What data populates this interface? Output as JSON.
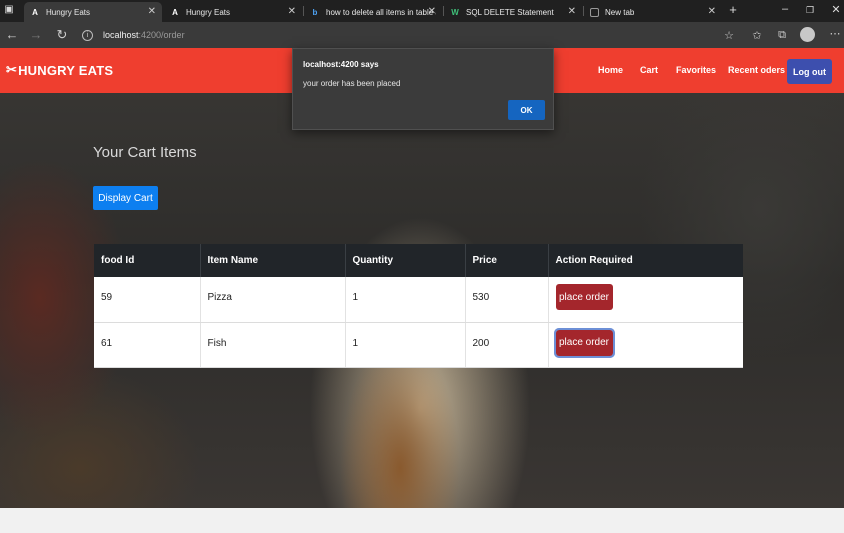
{
  "browser": {
    "tabs": [
      {
        "label": "Hungry Eats",
        "favicon": "A",
        "active": true
      },
      {
        "label": "Hungry Eats",
        "favicon": "A",
        "active": false
      },
      {
        "label": "how to delete all items in table a",
        "favicon": "b",
        "active": false
      },
      {
        "label": "SQL DELETE Statement",
        "favicon": "W",
        "active": false
      },
      {
        "label": "New tab",
        "favicon": "",
        "active": false
      }
    ],
    "url_host": "localhost",
    "url_path": ":4200/order"
  },
  "navbar": {
    "brand": "HUNGRY EATS",
    "links": [
      "Home",
      "Cart",
      "Favorites",
      "Recent oders"
    ],
    "logout": "Log out",
    "color": "#ef3e2f"
  },
  "main": {
    "title": "Your Cart Items",
    "display_cart_label": "Display Cart",
    "table": {
      "headers": [
        "food Id",
        "Item Name",
        "Quantity",
        "Price",
        "Action Required"
      ],
      "rows": [
        {
          "food_id": "59",
          "item_name": "Pizza",
          "quantity": "1",
          "price": "530",
          "action": "place order"
        },
        {
          "food_id": "61",
          "item_name": "Fish",
          "quantity": "1",
          "price": "200",
          "action": "place order"
        }
      ]
    }
  },
  "alert": {
    "title": "localhost:4200 says",
    "message": "your order has been placed",
    "ok_label": "OK"
  }
}
